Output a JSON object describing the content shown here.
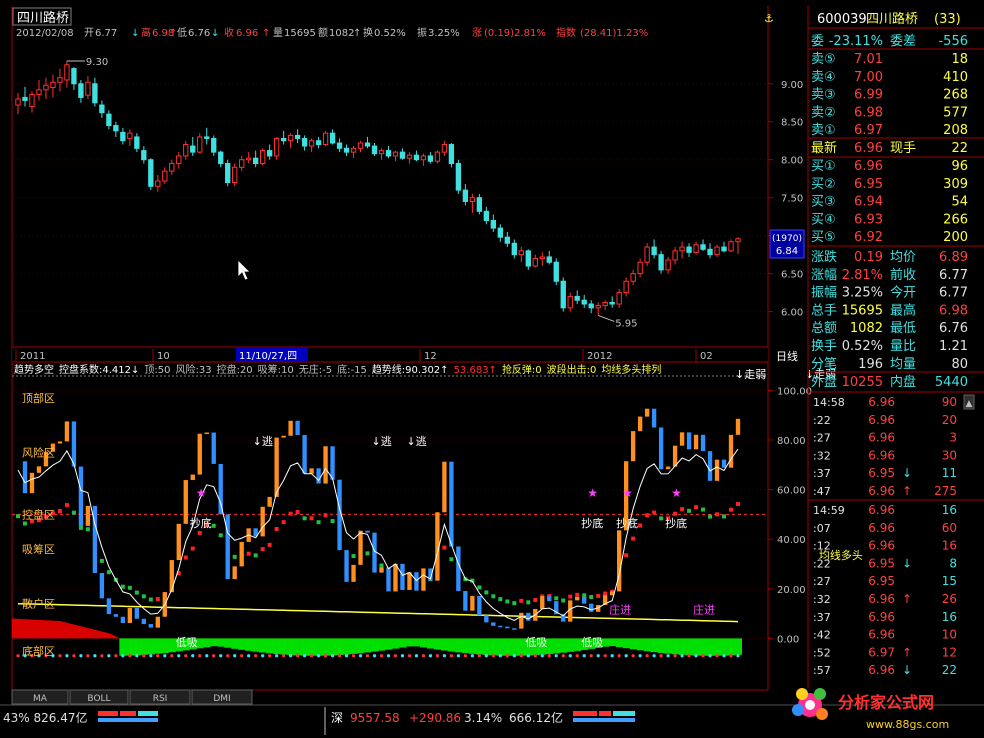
{
  "window": {
    "stock_name": "四川路桥",
    "code": "600039",
    "code_name": "四川路桥(33)",
    "period": "日线"
  },
  "header_bar": {
    "date": "2012/02/08",
    "open_label": "开",
    "open": "6.77",
    "high_label": "高",
    "high": "6.98",
    "low_label": "低",
    "low": "6.76",
    "close_label": "收",
    "close": "6.96",
    "vol_label": "量",
    "vol": "15695",
    "amt_label": "额",
    "amt": "1082",
    "turn_label": "换",
    "turn": "0.52%",
    "amp_label": "振",
    "amp": "3.25%",
    "chg_label": "涨",
    "chg": "(0.19)2.81%",
    "idx_label": "指数",
    "idx": "(28.41)1.23%"
  },
  "price_chart": {
    "price_axis_labels": [
      "9.00",
      "8.50",
      "8.00",
      "7.50",
      "7.00",
      "6.50",
      "6.00"
    ],
    "price_ticks": [
      9.0,
      8.5,
      8.0,
      7.5,
      7.0,
      6.5,
      6.0
    ],
    "ylim": [
      5.6,
      9.55
    ],
    "hi_mark": "9.30",
    "lo_mark": "5.95",
    "cursor_tag_top": "(1970)",
    "cursor_tag_value": "6.84",
    "date_axis": [
      "2011",
      "10",
      "11/10/27,四",
      "12",
      "2012",
      "02"
    ]
  },
  "indicator": {
    "legend": [
      {
        "text": "趋势多空",
        "color": "#ffffff"
      },
      {
        "text": "控盘系数:4.412↓",
        "color": "#ffffff"
      },
      {
        "text": "顶:50",
        "color": "#c0c0c0"
      },
      {
        "text": "风险:33",
        "color": "#c0c0c0"
      },
      {
        "text": "控盘:20",
        "color": "#c0c0c0"
      },
      {
        "text": "吸筹:10",
        "color": "#c0c0c0"
      },
      {
        "text": "无庄:-5",
        "color": "#c0c0c0"
      },
      {
        "text": "底:-15",
        "color": "#c0c0c0"
      },
      {
        "text": "趋势线:90.302↑",
        "color": "#ffffff"
      },
      {
        "text": "53.683↑",
        "color": "#ff3030"
      },
      {
        "text": "抢反弹:0",
        "color": "#ffff40"
      },
      {
        "text": "波段出击:0",
        "color": "#ffff40"
      },
      {
        "text": "均线多头排列",
        "color": "#ffff40"
      }
    ],
    "axis_labels": [
      "100.00",
      "80.00",
      "60.00",
      "40.00",
      "20.00",
      "0.00"
    ],
    "ticks": [
      100,
      80,
      60,
      40,
      20,
      0
    ],
    "ylim": [
      -20,
      105
    ],
    "zones": [
      {
        "text": "顶部区",
        "value": 97
      },
      {
        "text": "风险区",
        "value": 75
      },
      {
        "text": "控盘区",
        "value": 50
      },
      {
        "text": "吸筹区",
        "value": 36
      },
      {
        "text": "散户区",
        "value": 14
      },
      {
        "text": "底部区",
        "value": -5
      }
    ],
    "annotations": [
      {
        "text": "↓走弱",
        "index": 104,
        "value": 105
      },
      {
        "text": "↓走弱",
        "index": 114,
        "value": 105
      },
      {
        "text": "↓逃",
        "index": 35,
        "value": 78
      },
      {
        "text": "↓逃",
        "index": 52,
        "value": 78
      },
      {
        "text": "↓逃",
        "index": 57,
        "value": 78
      },
      {
        "text": "抄底",
        "index": 26,
        "value": 45
      },
      {
        "text": "抄底",
        "index": 82,
        "value": 45
      },
      {
        "text": "抄底",
        "index": 87,
        "value": 45
      },
      {
        "text": "抄底",
        "index": 94,
        "value": 45
      },
      {
        "text": "均线多头",
        "index": 116,
        "value": 32
      },
      {
        "text": "低吸",
        "index": 24,
        "value": -3
      },
      {
        "text": "低吸",
        "index": 74,
        "value": -3
      },
      {
        "text": "低吸",
        "index": 82,
        "value": -3
      },
      {
        "text": "庄进",
        "index": 86,
        "value": 10
      },
      {
        "text": "庄进",
        "index": 98,
        "value": 10
      }
    ]
  },
  "tabs": [
    "MA",
    "BOLL",
    "RSI",
    "DMI"
  ],
  "quote_panel": {
    "wei_label": "委",
    "wei_bi": "-23.11%",
    "wei_cha_label": "委差",
    "wei_cha": "-556",
    "asks": [
      {
        "label": "卖⑤",
        "price": "7.01",
        "vol": "18"
      },
      {
        "label": "卖④",
        "price": "7.00",
        "vol": "410"
      },
      {
        "label": "卖③",
        "price": "6.99",
        "vol": "268"
      },
      {
        "label": "卖②",
        "price": "6.98",
        "vol": "577"
      },
      {
        "label": "卖①",
        "price": "6.97",
        "vol": "208"
      }
    ],
    "last_label": "最新",
    "last": "6.96",
    "hand_label": "现手",
    "hand": "22",
    "bids": [
      {
        "label": "买①",
        "price": "6.96",
        "vol": "96"
      },
      {
        "label": "买②",
        "price": "6.95",
        "vol": "309"
      },
      {
        "label": "买③",
        "price": "6.94",
        "vol": "54"
      },
      {
        "label": "买④",
        "price": "6.93",
        "vol": "266"
      },
      {
        "label": "买⑤",
        "price": "6.92",
        "vol": "200"
      }
    ],
    "stats": [
      {
        "l1": "涨跌",
        "v1": "0.19",
        "c1": "#ff4040",
        "l2": "均价",
        "v2": "6.89",
        "c2": "#ff4040"
      },
      {
        "l1": "涨幅",
        "v1": "2.81%",
        "c1": "#ff4040",
        "l2": "前收",
        "v2": "6.77",
        "c2": "#e0e0e0"
      },
      {
        "l1": "振幅",
        "v1": "3.25%",
        "c1": "#e0e0e0",
        "l2": "今开",
        "v2": "6.77",
        "c2": "#e0e0e0"
      },
      {
        "l1": "总手",
        "v1": "15695",
        "c1": "#ffff40",
        "l2": "最高",
        "v2": "6.98",
        "c2": "#ff4040"
      },
      {
        "l1": "总额",
        "v1": "1082",
        "c1": "#ffff40",
        "l2": "最低",
        "v2": "6.76",
        "c2": "#e0e0e0"
      },
      {
        "l1": "换手",
        "v1": "0.52%",
        "c1": "#e0e0e0",
        "l2": "量比",
        "v2": "1.21",
        "c2": "#e0e0e0"
      },
      {
        "l1": "分笔",
        "v1": "196",
        "c1": "#e0e0e0",
        "l2": "均量",
        "v2": "80",
        "c2": "#e0e0e0"
      }
    ],
    "outer_label": "外盘",
    "outer": "10255",
    "inner_label": "内盘",
    "inner": "5440",
    "ticks_a": [
      {
        "t": "14:58",
        "p": "6.96",
        "a": "",
        "v": "90",
        "c": "#ff4040"
      },
      {
        "t": ":22",
        "p": "6.96",
        "a": "",
        "v": "20",
        "c": "#ff4040"
      },
      {
        "t": ":27",
        "p": "6.96",
        "a": "",
        "v": "3",
        "c": "#ff4040"
      },
      {
        "t": ":32",
        "p": "6.96",
        "a": "",
        "v": "30",
        "c": "#ff4040"
      },
      {
        "t": ":37",
        "p": "6.95",
        "a": "↓",
        "v": "11",
        "c": "#40e0e0"
      },
      {
        "t": ":47",
        "p": "6.96",
        "a": "↑",
        "v": "275",
        "c": "#ff4040"
      }
    ],
    "ticks_b": [
      {
        "t": "14:59",
        "p": "6.96",
        "a": "",
        "v": "16",
        "c": "#40e0e0"
      },
      {
        "t": ":07",
        "p": "6.96",
        "a": "",
        "v": "60",
        "c": "#ff4040"
      },
      {
        "t": ":12",
        "p": "6.96",
        "a": "",
        "v": "16",
        "c": "#ff4040"
      },
      {
        "t": ":22",
        "p": "6.95",
        "a": "↓",
        "v": "8",
        "c": "#40e0e0"
      },
      {
        "t": ":27",
        "p": "6.95",
        "a": "",
        "v": "15",
        "c": "#40e0e0"
      },
      {
        "t": ":32",
        "p": "6.96",
        "a": "↑",
        "v": "26",
        "c": "#ff4040"
      },
      {
        "t": ":37",
        "p": "6.96",
        "a": "",
        "v": "16",
        "c": "#40e0e0"
      },
      {
        "t": ":42",
        "p": "6.96",
        "a": "",
        "v": "10",
        "c": "#ff4040"
      },
      {
        "t": ":52",
        "p": "6.97",
        "a": "↑",
        "v": "12",
        "c": "#ff4040"
      },
      {
        "t": ":57",
        "p": "6.96",
        "a": "↓",
        "v": "22",
        "c": "#40e0e0"
      }
    ]
  },
  "status_bar": {
    "left": "43% 826.47亿",
    "shen_label": "深",
    "shen_index": "9557.58",
    "shen_change": "+290.86",
    "shen_pct": "3.14%",
    "shen_amount": "666.12亿",
    "logo_text": "分析家公式网",
    "logo_url": "www.88gs.com"
  },
  "chart_data": {
    "type": "candlestick",
    "title": "四川路桥 日线",
    "x": [
      "2011",
      "10",
      "11/10/27,四",
      "12",
      "2012",
      "02"
    ],
    "ylabel": "",
    "ylim": [
      5.6,
      9.55
    ],
    "candles": [
      [
        8.72,
        8.88,
        8.6,
        8.8
      ],
      [
        8.82,
        8.96,
        8.7,
        8.78
      ],
      [
        8.7,
        8.9,
        8.62,
        8.86
      ],
      [
        8.86,
        9.05,
        8.78,
        8.92
      ],
      [
        8.92,
        9.08,
        8.8,
        8.98
      ],
      [
        8.95,
        9.12,
        8.82,
        9.02
      ],
      [
        9.02,
        9.2,
        8.9,
        9.08
      ],
      [
        9.05,
        9.3,
        8.95,
        9.25
      ],
      [
        9.2,
        9.22,
        8.92,
        9.0
      ],
      [
        9.0,
        9.05,
        8.75,
        8.82
      ],
      [
        8.85,
        9.1,
        8.8,
        9.02
      ],
      [
        9.0,
        9.08,
        8.7,
        8.75
      ],
      [
        8.72,
        8.78,
        8.55,
        8.62
      ],
      [
        8.6,
        8.65,
        8.4,
        8.45
      ],
      [
        8.45,
        8.5,
        8.3,
        8.38
      ],
      [
        8.36,
        8.42,
        8.2,
        8.25
      ],
      [
        8.28,
        8.4,
        8.18,
        8.35
      ],
      [
        8.3,
        8.35,
        8.1,
        8.15
      ],
      [
        8.12,
        8.18,
        7.95,
        8.0
      ],
      [
        8.0,
        8.02,
        7.6,
        7.65
      ],
      [
        7.65,
        7.8,
        7.58,
        7.72
      ],
      [
        7.72,
        7.9,
        7.68,
        7.85
      ],
      [
        7.85,
        8.0,
        7.8,
        7.95
      ],
      [
        7.95,
        8.1,
        7.88,
        8.05
      ],
      [
        8.05,
        8.25,
        8.0,
        8.2
      ],
      [
        8.18,
        8.3,
        8.05,
        8.1
      ],
      [
        8.1,
        8.35,
        8.08,
        8.3
      ],
      [
        8.3,
        8.42,
        8.2,
        8.28
      ],
      [
        8.28,
        8.32,
        8.05,
        8.1
      ],
      [
        8.1,
        8.12,
        7.9,
        7.95
      ],
      [
        7.95,
        8.0,
        7.65,
        7.7
      ],
      [
        7.7,
        7.95,
        7.65,
        7.9
      ],
      [
        7.9,
        8.05,
        7.85,
        8.0
      ],
      [
        8.0,
        8.1,
        7.95,
        8.02
      ],
      [
        8.02,
        8.12,
        7.9,
        7.95
      ],
      [
        7.95,
        8.15,
        7.92,
        8.12
      ],
      [
        8.12,
        8.2,
        8.0,
        8.05
      ],
      [
        8.05,
        8.3,
        8.0,
        8.28
      ],
      [
        8.28,
        8.38,
        8.2,
        8.25
      ],
      [
        8.25,
        8.35,
        8.15,
        8.32
      ],
      [
        8.32,
        8.4,
        8.22,
        8.28
      ],
      [
        8.28,
        8.32,
        8.12,
        8.18
      ],
      [
        8.18,
        8.28,
        8.1,
        8.25
      ],
      [
        8.25,
        8.3,
        8.15,
        8.2
      ],
      [
        8.2,
        8.38,
        8.18,
        8.35
      ],
      [
        8.35,
        8.4,
        8.2,
        8.22
      ],
      [
        8.22,
        8.28,
        8.1,
        8.15
      ],
      [
        8.15,
        8.2,
        8.05,
        8.1
      ],
      [
        8.1,
        8.18,
        8.02,
        8.15
      ],
      [
        8.15,
        8.25,
        8.1,
        8.22
      ],
      [
        8.22,
        8.3,
        8.15,
        8.18
      ],
      [
        8.18,
        8.22,
        8.05,
        8.08
      ],
      [
        8.08,
        8.15,
        8.0,
        8.12
      ],
      [
        8.12,
        8.18,
        8.02,
        8.05
      ],
      [
        8.05,
        8.12,
        7.98,
        8.1
      ],
      [
        8.1,
        8.15,
        8.0,
        8.02
      ],
      [
        8.02,
        8.1,
        7.95,
        8.06
      ],
      [
        8.06,
        8.12,
        7.98,
        8.0
      ],
      [
        8.0,
        8.08,
        7.92,
        8.05
      ],
      [
        8.05,
        8.1,
        7.95,
        7.98
      ],
      [
        7.98,
        8.12,
        7.95,
        8.1
      ],
      [
        8.1,
        8.25,
        8.05,
        8.2
      ],
      [
        8.2,
        8.22,
        7.9,
        7.95
      ],
      [
        7.95,
        8.0,
        7.55,
        7.6
      ],
      [
        7.6,
        7.68,
        7.4,
        7.45
      ],
      [
        7.45,
        7.55,
        7.3,
        7.5
      ],
      [
        7.5,
        7.55,
        7.28,
        7.32
      ],
      [
        7.32,
        7.38,
        7.15,
        7.2
      ],
      [
        7.2,
        7.28,
        7.05,
        7.1
      ],
      [
        7.1,
        7.15,
        6.92,
        6.98
      ],
      [
        6.98,
        7.05,
        6.85,
        6.9
      ],
      [
        6.9,
        6.95,
        6.7,
        6.75
      ],
      [
        6.75,
        6.85,
        6.65,
        6.8
      ],
      [
        6.8,
        6.82,
        6.55,
        6.6
      ],
      [
        6.6,
        6.75,
        6.58,
        6.7
      ],
      [
        6.7,
        6.78,
        6.6,
        6.72
      ],
      [
        6.72,
        6.8,
        6.62,
        6.65
      ],
      [
        6.65,
        6.7,
        6.35,
        6.4
      ],
      [
        6.4,
        6.45,
        6.0,
        6.05
      ],
      [
        6.05,
        6.25,
        6.0,
        6.2
      ],
      [
        6.2,
        6.28,
        6.1,
        6.15
      ],
      [
        6.15,
        6.22,
        6.05,
        6.1
      ],
      [
        6.1,
        6.15,
        5.98,
        6.05
      ],
      [
        6.05,
        6.12,
        5.95,
        6.08
      ],
      [
        6.08,
        6.15,
        6.02,
        6.12
      ],
      [
        6.12,
        6.2,
        6.05,
        6.1
      ],
      [
        6.1,
        6.3,
        6.05,
        6.25
      ],
      [
        6.25,
        6.45,
        6.2,
        6.4
      ],
      [
        6.4,
        6.55,
        6.35,
        6.5
      ],
      [
        6.5,
        6.7,
        6.45,
        6.65
      ],
      [
        6.65,
        6.9,
        6.6,
        6.85
      ],
      [
        6.85,
        6.95,
        6.7,
        6.75
      ],
      [
        6.75,
        6.8,
        6.5,
        6.55
      ],
      [
        6.55,
        6.72,
        6.5,
        6.68
      ],
      [
        6.68,
        6.85,
        6.62,
        6.8
      ],
      [
        6.8,
        6.92,
        6.7,
        6.85
      ],
      [
        6.85,
        6.9,
        6.72,
        6.78
      ],
      [
        6.78,
        6.92,
        6.75,
        6.88
      ],
      [
        6.88,
        6.95,
        6.8,
        6.82
      ],
      [
        6.82,
        6.9,
        6.7,
        6.75
      ],
      [
        6.75,
        6.88,
        6.72,
        6.85
      ],
      [
        6.85,
        6.92,
        6.78,
        6.8
      ],
      [
        6.8,
        6.95,
        6.78,
        6.92
      ],
      [
        6.92,
        6.98,
        6.76,
        6.96
      ]
    ]
  }
}
